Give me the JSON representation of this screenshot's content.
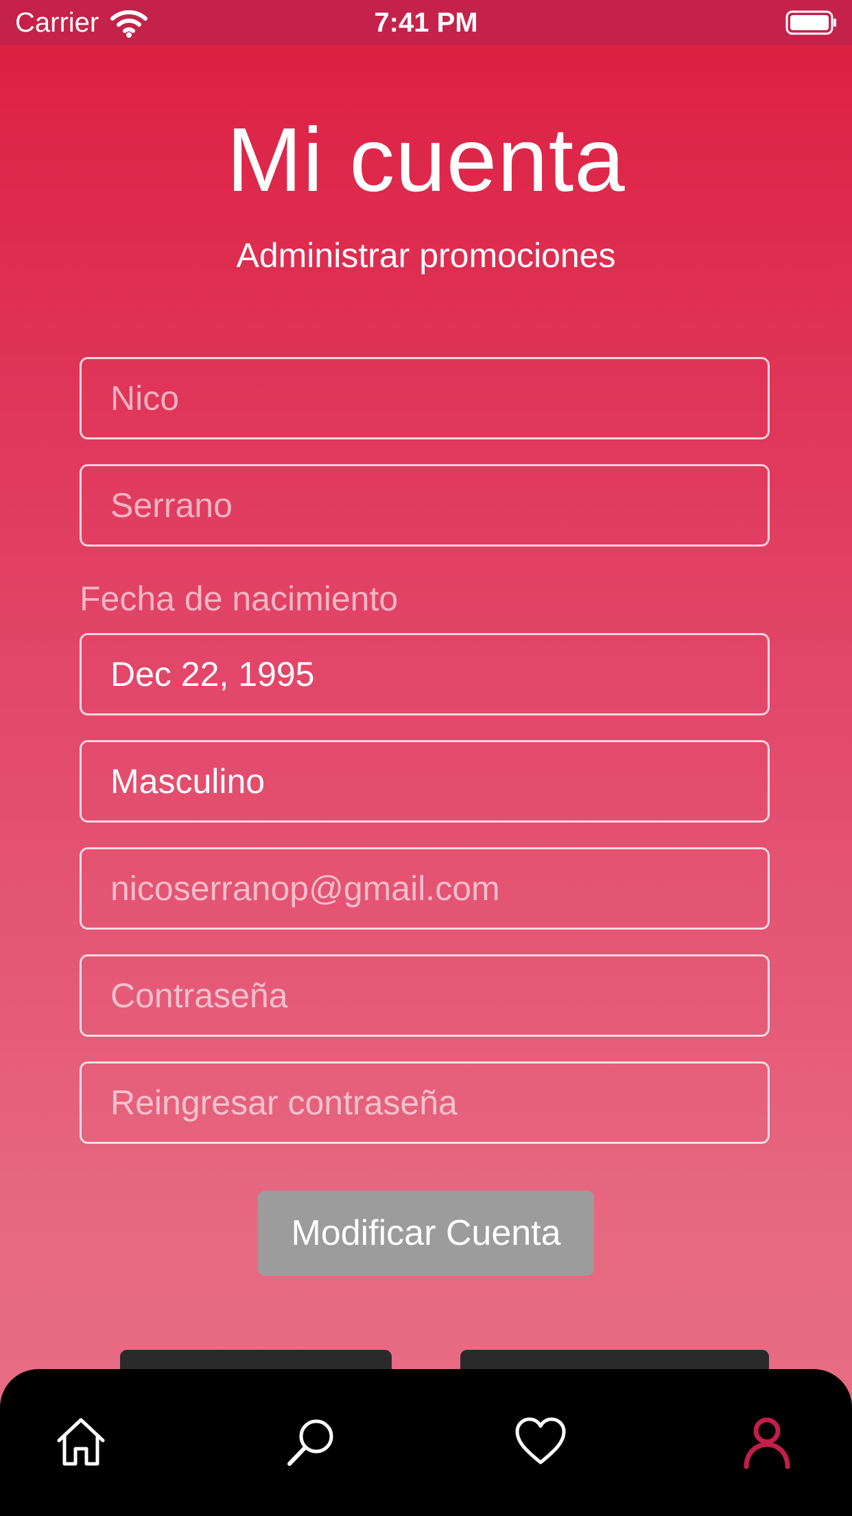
{
  "status_bar": {
    "carrier": "Carrier",
    "time": "7:41 PM",
    "wifi_icon": "wifi-icon",
    "battery_icon": "battery-icon"
  },
  "header": {
    "title": "Mi cuenta",
    "subtitle": "Administrar promociones"
  },
  "form": {
    "first_name": "Nico",
    "last_name": "Serrano",
    "birth_label": "Fecha de nacimiento",
    "birth_date": "Dec 22, 1995",
    "gender": "Masculino",
    "email": "nicoserranop@gmail.com",
    "password_placeholder": "Contraseña",
    "password_repeat_placeholder": "Reingresar contraseña",
    "submit_label": "Modificar Cuenta"
  },
  "tab_bar": {
    "tabs": [
      {
        "icon": "home-icon"
      },
      {
        "icon": "search-icon"
      },
      {
        "icon": "heart-icon"
      },
      {
        "icon": "profile-icon",
        "active": true
      }
    ],
    "active_color": "#c31e4a",
    "inactive_color": "#ffffff"
  },
  "colors": {
    "status_bar_bg": "#c4224a",
    "gradient_top": "#dc1e40",
    "gradient_bottom": "#e86d85",
    "button_bg": "#9c9c9c"
  }
}
